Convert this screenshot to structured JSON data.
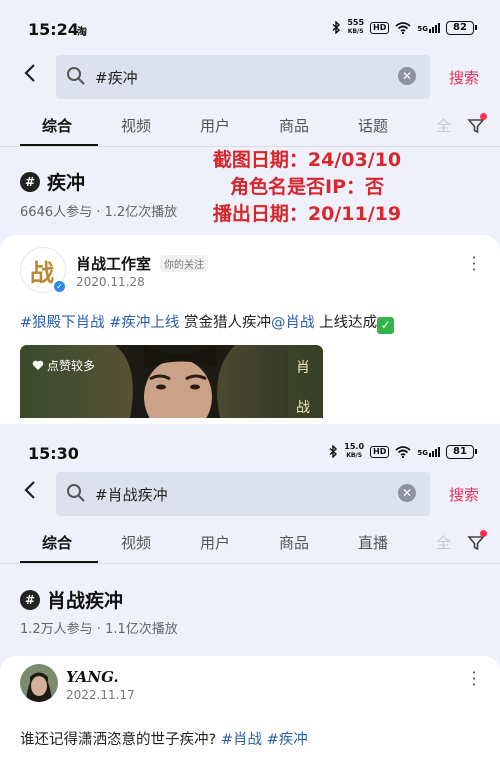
{
  "overlay": {
    "line1": "截图日期：24/03/10",
    "line2": "角色名是否IP：否",
    "line3": "播出日期：20/11/19"
  },
  "screens": [
    {
      "status": {
        "time": "15:24",
        "app_icon": "淘",
        "net_speed_value": "555",
        "net_speed_unit": "KB/S",
        "hd": "HD",
        "signal_label": "5G",
        "battery": "82"
      },
      "search": {
        "query": "#疾冲",
        "button": "搜索"
      },
      "tabs": [
        "综合",
        "视频",
        "用户",
        "商品",
        "话题",
        "全"
      ],
      "topic": {
        "hash": "#",
        "name": "疾冲",
        "stats": "6646人参与 · 1.2亿次播放"
      },
      "post": {
        "author": "肖战工作室",
        "follow_badge": "你的关注",
        "date": "2020.11.28",
        "avatar_text": "战",
        "text_parts": [
          "#狼殿下肖战",
          " ",
          "#疾冲上线",
          " 赏金猎人疾冲",
          "@肖战",
          " 上线达成",
          "✓"
        ],
        "like_badge": "点赞较多",
        "image_text_1": "肖",
        "image_text_2": "战"
      }
    },
    {
      "status": {
        "time": "15:30",
        "net_speed_value": "15.0",
        "net_speed_unit": "KB/S",
        "hd": "HD",
        "signal_label": "5G",
        "battery": "81"
      },
      "search": {
        "query": "#肖战疾冲",
        "button": "搜索"
      },
      "tabs": [
        "综合",
        "视频",
        "用户",
        "商品",
        "直播",
        "全"
      ],
      "topic": {
        "hash": "#",
        "name": "肖战疾冲",
        "stats": "1.2万人参与 · 1.1亿次播放"
      },
      "post": {
        "author": "YANG.",
        "date": "2022.11.17",
        "text_parts": [
          "谁还记得潇洒恣意的世子疾冲? ",
          "#肖战",
          " ",
          "#疾冲"
        ]
      }
    }
  ]
}
